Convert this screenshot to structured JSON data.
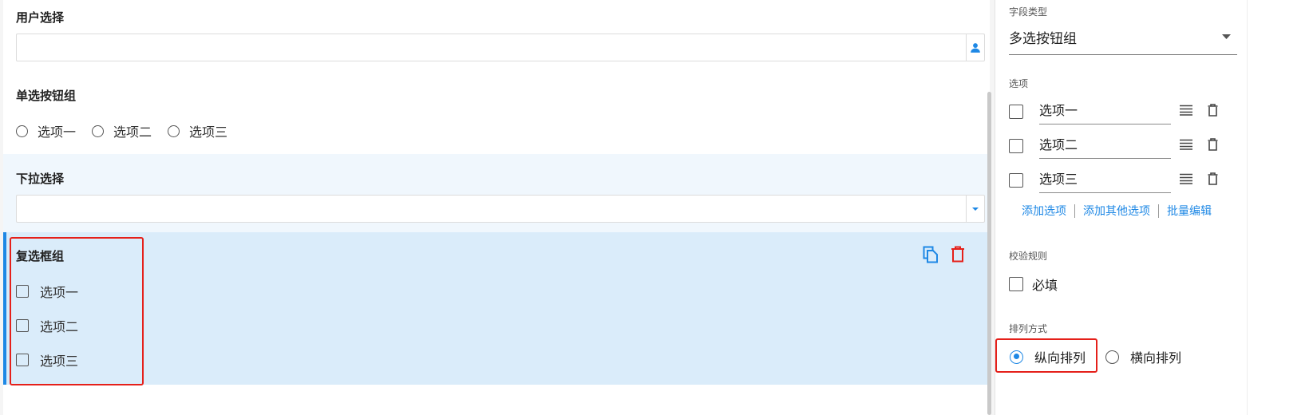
{
  "form": {
    "user_select": {
      "label": "用户选择",
      "value": ""
    },
    "radio_group": {
      "label": "单选按钮组",
      "options": [
        "选项一",
        "选项二",
        "选项三"
      ]
    },
    "dropdown": {
      "label": "下拉选择",
      "value": ""
    },
    "checkbox_group": {
      "label": "复选框组",
      "options": [
        "选项一",
        "选项二",
        "选项三"
      ]
    }
  },
  "panel": {
    "field_type": {
      "label": "字段类型",
      "value": "多选按钮组"
    },
    "options": {
      "label": "选项",
      "items": [
        "选项一",
        "选项二",
        "选项三"
      ],
      "links": {
        "add_option": "添加选项",
        "add_other": "添加其他选项",
        "batch_edit": "批量编辑"
      }
    },
    "validation": {
      "label": "校验规则",
      "required_label": "必填",
      "required_checked": false
    },
    "layout": {
      "label": "排列方式",
      "vertical": "纵向排列",
      "horizontal": "横向排列",
      "selected": "vertical"
    }
  },
  "colors": {
    "accent": "#1e88e5",
    "danger": "#e5201a",
    "selected_bg": "#daecfa",
    "hover_bg": "#f0f7fd"
  },
  "icons": {
    "user": "person-icon",
    "dropdown": "caret-down-icon",
    "copy": "copy-icon",
    "delete": "trash-icon",
    "drag": "drag-handle-icon"
  }
}
